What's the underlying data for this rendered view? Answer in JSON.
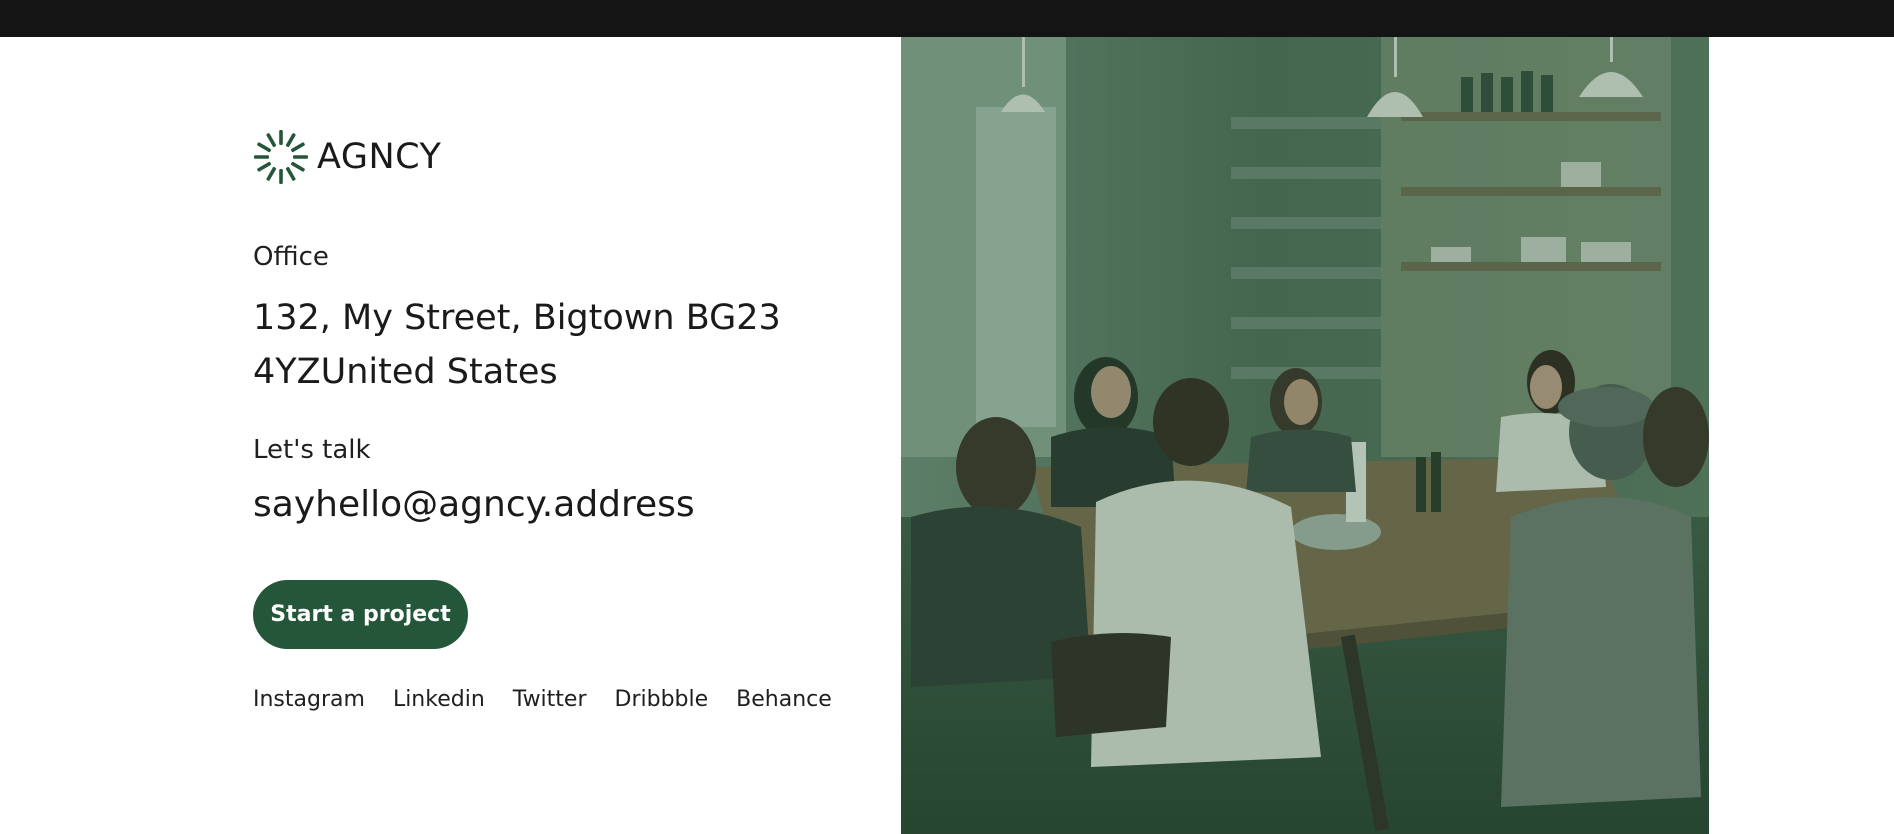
{
  "brand": {
    "name": "AGNCY",
    "color": "#245639"
  },
  "contact": {
    "office_label": "Office",
    "address": "132, My Street, Bigtown BG23 4YZUnited States",
    "talk_label": "Let's talk",
    "email": "sayhello@agncy.address"
  },
  "cta": {
    "label": "Start a project"
  },
  "social": {
    "links": [
      {
        "label": "Instagram"
      },
      {
        "label": "Linkedin"
      },
      {
        "label": "Twitter"
      },
      {
        "label": "Dribbble"
      },
      {
        "label": "Behance"
      }
    ]
  },
  "image": {
    "icon": "team-meeting-photo",
    "tint": "#2f5a3c"
  }
}
